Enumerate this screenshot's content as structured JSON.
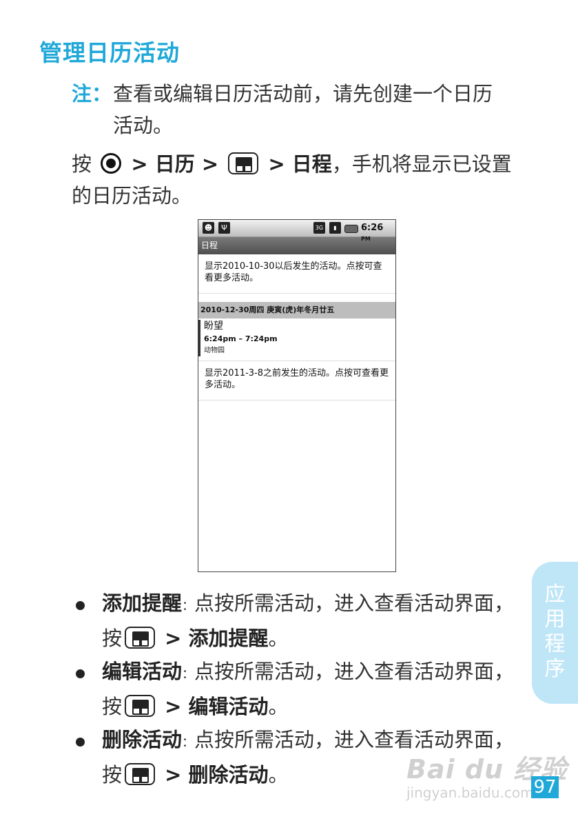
{
  "title": "管理日历活动",
  "note": {
    "label": "注：",
    "line1": "查看或编辑日历活动前，请先创建一个日历",
    "line2": "活动。"
  },
  "intro": {
    "press": "按",
    "sep1": " > ",
    "calendar": "日历",
    "sep2": " > ",
    "sep3": " > ",
    "agenda": "日程",
    "rest": "，手机将显示已设置的日历活动。"
  },
  "phone": {
    "status_time": "6:26",
    "status_ampm": "PM",
    "net_label": "3G",
    "app_title": "日程",
    "top_message": "显示2010-10-30以后发生的活动。点按可查看更多活动。",
    "date_header": "2010-12-30周四 庚寅(虎)年冬月廿五",
    "event": {
      "title": "盼望",
      "time": "6:24pm – 7:24pm",
      "location": "动物园"
    },
    "bottom_message": "显示2011-3-8之前发生的活动。点按可查看更多活动。"
  },
  "bullets": [
    {
      "term": "添加提醒",
      "colon": "：",
      "desc": "点按所需活动，进入查看活动界面，按",
      "sep": " > ",
      "action": "添加提醒",
      "end": "。"
    },
    {
      "term": "编辑活动",
      "colon": "：",
      "desc": "点按所需活动，进入查看活动界面，按",
      "sep": " > ",
      "action": "编辑活动",
      "end": "。"
    },
    {
      "term": "删除活动",
      "colon": "：",
      "desc": "点按所需活动，进入查看活动界面，按",
      "sep": " > ",
      "action": "删除活动",
      "end": "。"
    }
  ],
  "side_tab": [
    "应",
    "用",
    "程",
    "序"
  ],
  "watermark": {
    "brand": "Bai du 经验",
    "url": "jingyan.baidu.com"
  },
  "page_number": "97",
  "colors": {
    "accent": "#1fa8d8",
    "tab": "#bfe6f7"
  }
}
